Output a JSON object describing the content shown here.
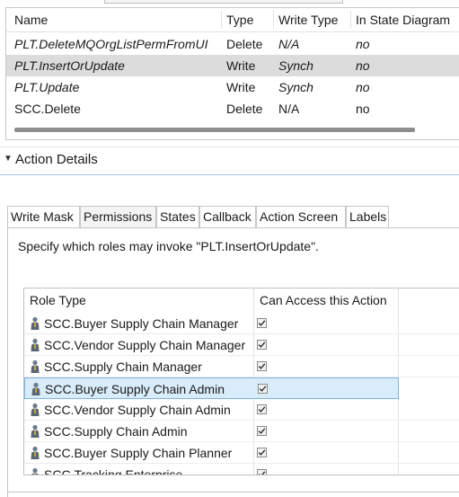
{
  "actions_table": {
    "columns": [
      "Name",
      "Type",
      "Write Type",
      "In State Diagram"
    ],
    "rows": [
      {
        "name": "PLT.DeleteMQOrgListPermFromUI",
        "type": "Delete",
        "write_type": "N/A",
        "in_state": "no",
        "italic": true,
        "selected": false
      },
      {
        "name": "PLT.InsertOrUpdate",
        "type": "Write",
        "write_type": "Synch",
        "in_state": "no",
        "italic": true,
        "selected": true
      },
      {
        "name": "PLT.Update",
        "type": "Write",
        "write_type": "Synch",
        "in_state": "no",
        "italic": true,
        "selected": false
      },
      {
        "name": "SCC.Delete",
        "type": "Delete",
        "write_type": "N/A",
        "in_state": "no",
        "italic": false,
        "selected": false
      }
    ]
  },
  "section": {
    "title": "Action Details",
    "arrow": "expanded"
  },
  "tabs": [
    {
      "label": "Write Mask",
      "active": false
    },
    {
      "label": "Permissions",
      "active": true
    },
    {
      "label": "States",
      "active": false
    },
    {
      "label": "Callback",
      "active": false
    },
    {
      "label": "Action Screen",
      "active": false
    },
    {
      "label": "Labels",
      "active": false
    }
  ],
  "permissions": {
    "description": "Specify which roles may invoke \"PLT.InsertOrUpdate\".",
    "columns": [
      "Role Type",
      "Can Access this Action"
    ],
    "roles": [
      {
        "name": "SCC.Buyer Supply Chain Manager",
        "checked": true,
        "selected": false
      },
      {
        "name": "SCC.Vendor Supply Chain Manager",
        "checked": true,
        "selected": false
      },
      {
        "name": "SCC.Supply Chain Manager",
        "checked": true,
        "selected": false
      },
      {
        "name": "SCC.Buyer Supply Chain Admin",
        "checked": true,
        "selected": true
      },
      {
        "name": "SCC.Vendor Supply Chain Admin",
        "checked": true,
        "selected": false
      },
      {
        "name": "SCC.Supply Chain Admin",
        "checked": true,
        "selected": false
      },
      {
        "name": "SCC.Buyer Supply Chain Planner",
        "checked": true,
        "selected": false
      },
      {
        "name": "SCC.Tracking Enterprise",
        "checked": true,
        "selected": false
      }
    ]
  },
  "icons": {
    "role": "person-role-icon",
    "checkbox": "checkmark-icon",
    "section_arrow": "triangle-down-icon"
  },
  "colors": {
    "selection_grey": "#dcdcdc",
    "selection_blue": "#d9ecf9",
    "selection_border": "#7fb4e0",
    "section_rule": "#a7c8e4"
  }
}
